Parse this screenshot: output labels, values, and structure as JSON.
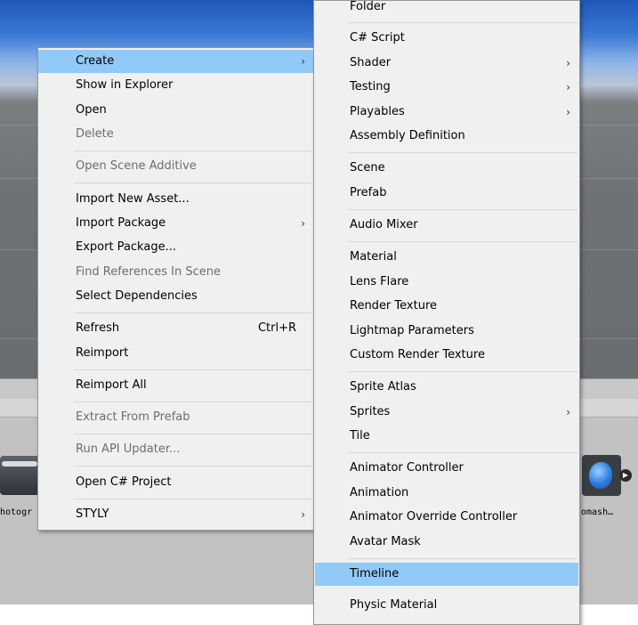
{
  "assets": {
    "left_label": "hotogr",
    "right_label": "omash…"
  },
  "context_menu": {
    "items": [
      {
        "label": "Create",
        "arrow": "›",
        "highlighted": true
      },
      {
        "label": "Show in Explorer"
      },
      {
        "label": "Open"
      },
      {
        "label": "Delete",
        "disabled": true
      },
      {
        "label": "Open Scene Additive",
        "disabled": true
      },
      {
        "label": "Import New Asset..."
      },
      {
        "label": "Import Package",
        "arrow": "›"
      },
      {
        "label": "Export Package..."
      },
      {
        "label": "Find References In Scene",
        "disabled": true
      },
      {
        "label": "Select Dependencies"
      },
      {
        "label": "Refresh",
        "shortcut": "Ctrl+R"
      },
      {
        "label": "Reimport"
      },
      {
        "label": "Reimport All"
      },
      {
        "label": "Extract From Prefab",
        "disabled": true
      },
      {
        "label": "Run API Updater...",
        "disabled": true
      },
      {
        "label": "Open C# Project"
      },
      {
        "label": "STYLY",
        "arrow": "›"
      }
    ]
  },
  "create_submenu": {
    "items": [
      {
        "label": "Folder"
      },
      {
        "label": "C# Script"
      },
      {
        "label": "Shader",
        "arrow": "›"
      },
      {
        "label": "Testing",
        "arrow": "›"
      },
      {
        "label": "Playables",
        "arrow": "›"
      },
      {
        "label": "Assembly Definition"
      },
      {
        "label": "Scene"
      },
      {
        "label": "Prefab"
      },
      {
        "label": "Audio Mixer"
      },
      {
        "label": "Material"
      },
      {
        "label": "Lens Flare"
      },
      {
        "label": "Render Texture"
      },
      {
        "label": "Lightmap Parameters"
      },
      {
        "label": "Custom Render Texture"
      },
      {
        "label": "Sprite Atlas"
      },
      {
        "label": "Sprites",
        "arrow": "›"
      },
      {
        "label": "Tile"
      },
      {
        "label": "Animator Controller"
      },
      {
        "label": "Animation"
      },
      {
        "label": "Animator Override Controller"
      },
      {
        "label": "Avatar Mask"
      },
      {
        "label": "Timeline",
        "highlighted": true
      },
      {
        "label": "Physic Material"
      }
    ]
  },
  "colors": {
    "menu_bg": "#f0f0f0",
    "highlight": "#91c9f7",
    "disabled_text": "#6d6d6d"
  }
}
